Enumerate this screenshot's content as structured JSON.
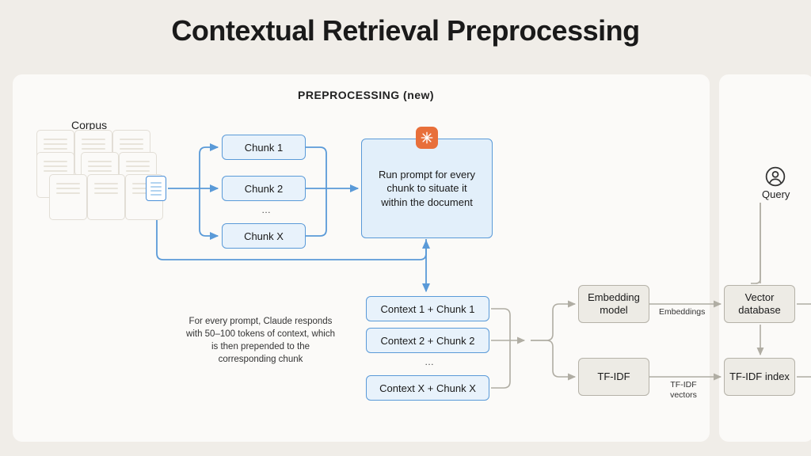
{
  "title": "Contextual Retrieval Preprocessing",
  "section_label": "PREPROCESSING (new)",
  "corpus_label": "Corpus",
  "chunks": {
    "c1": "Chunk 1",
    "c2": "Chunk 2",
    "cx": "Chunk X",
    "dots": "…"
  },
  "prompt_box": "Run prompt for every chunk to situate it within the document",
  "contexts": {
    "c1": "Context 1 + Chunk 1",
    "c2": "Context 2 + Chunk 2",
    "cx": "Context X + Chunk X",
    "dots": "…"
  },
  "caption": "For every prompt, Claude responds with 50–100 tokens of context, which is then prepended to the corresponding chunk",
  "embedding_model": "Embedding model",
  "tfidf": "TF-IDF",
  "vector_db": "Vector database",
  "tfidf_index": "TF-IDF index",
  "edge_embeddings": "Embeddings",
  "edge_tfidf_vectors": "TF-IDF vectors",
  "query_label": "Query"
}
